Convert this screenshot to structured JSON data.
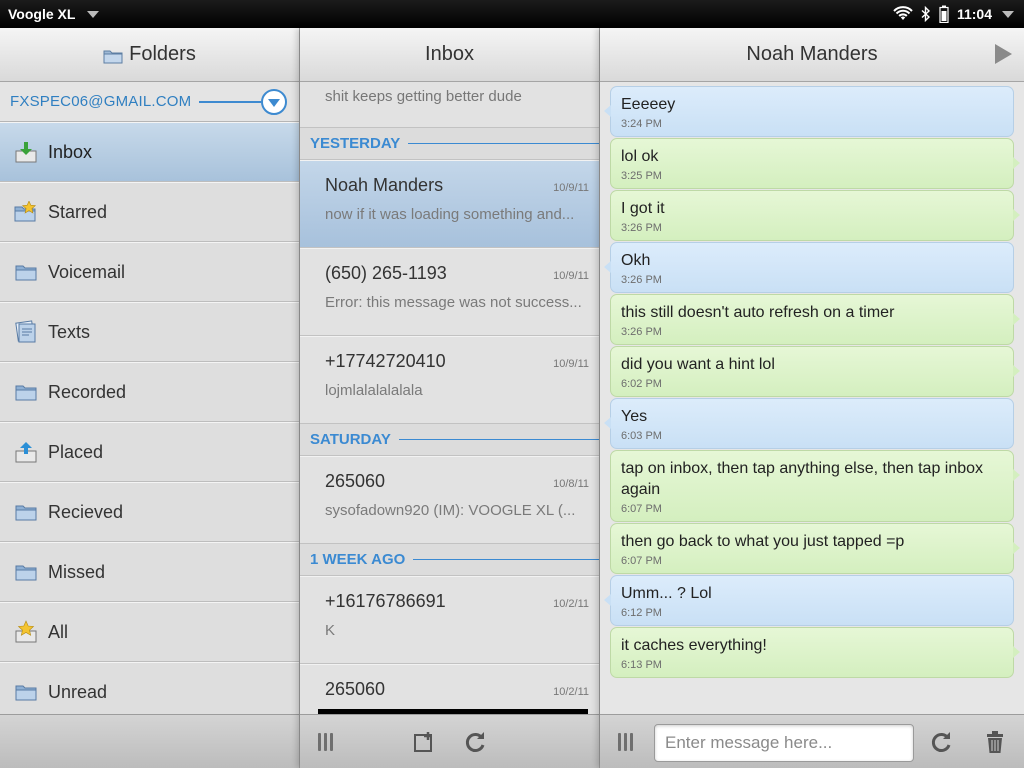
{
  "statusbar": {
    "app_name": "Voogle XL",
    "clock": "11:04"
  },
  "folders": {
    "title": "Folders",
    "account": "FXSPEC06@GMAIL.COM",
    "items": [
      {
        "label": "Inbox",
        "icon": "inbox-icon",
        "selected": true
      },
      {
        "label": "Starred",
        "icon": "starred-folder-icon"
      },
      {
        "label": "Voicemail",
        "icon": "folder-icon"
      },
      {
        "label": "Texts",
        "icon": "texts-icon"
      },
      {
        "label": "Recorded",
        "icon": "folder-icon"
      },
      {
        "label": "Placed",
        "icon": "placed-icon"
      },
      {
        "label": "Recieved",
        "icon": "folder-icon"
      },
      {
        "label": "Missed",
        "icon": "folder-icon"
      },
      {
        "label": "All",
        "icon": "all-icon"
      },
      {
        "label": "Unread",
        "icon": "folder-icon"
      }
    ]
  },
  "inbox": {
    "title": "Inbox",
    "top_preview": "shit keeps getting better dude",
    "groups": [
      {
        "label": "YESTERDAY",
        "messages": [
          {
            "sender": "Noah Manders",
            "date": "10/9/11",
            "preview": "now if it was loading something and..."
          },
          {
            "sender": "(650) 265-1193",
            "date": "10/9/11",
            "preview": "Error: this message was not success..."
          },
          {
            "sender": "+17742720410",
            "date": "10/9/11",
            "preview": "lojmlalalalalala"
          }
        ]
      },
      {
        "label": "SATURDAY",
        "messages": [
          {
            "sender": "265060",
            "date": "10/8/11",
            "preview": "sysofadown920 (IM): VOOGLE XL (..."
          }
        ]
      },
      {
        "label": "1 WEEK AGO",
        "messages": [
          {
            "sender": "+16176786691",
            "date": "10/2/11",
            "preview": "K"
          },
          {
            "sender": "265060",
            "date": "10/2/11",
            "preview": ""
          }
        ]
      }
    ]
  },
  "conversation": {
    "title": "Noah Manders",
    "messages": [
      {
        "dir": "in",
        "text": "Eeeeey",
        "time": "3:24 PM"
      },
      {
        "dir": "out",
        "text": "lol ok",
        "time": "3:25 PM"
      },
      {
        "dir": "out",
        "text": "I got it",
        "time": "3:26 PM"
      },
      {
        "dir": "in",
        "text": "Okh",
        "time": "3:26 PM"
      },
      {
        "dir": "out",
        "text": "this still doesn't auto refresh on a timer",
        "time": "3:26 PM"
      },
      {
        "dir": "out",
        "text": "did you want a hint lol",
        "time": "6:02 PM"
      },
      {
        "dir": "in",
        "text": "Yes",
        "time": "6:03 PM"
      },
      {
        "dir": "out",
        "text": "tap on inbox, then tap anything else, then tap inbox again",
        "time": "6:07 PM"
      },
      {
        "dir": "out",
        "text": "then go back to what you just tapped =p",
        "time": "6:07 PM"
      },
      {
        "dir": "in",
        "text": "Umm... ? Lol",
        "time": "6:12 PM"
      },
      {
        "dir": "out",
        "text": "it caches everything!",
        "time": "6:13 PM"
      }
    ],
    "input_placeholder": "Enter message here..."
  },
  "colors": {
    "accent": "#3b8ad2",
    "incoming_bubble": "#c9e0f5",
    "outgoing_bubble": "#d4efbf",
    "selection": "#a8c2db"
  }
}
